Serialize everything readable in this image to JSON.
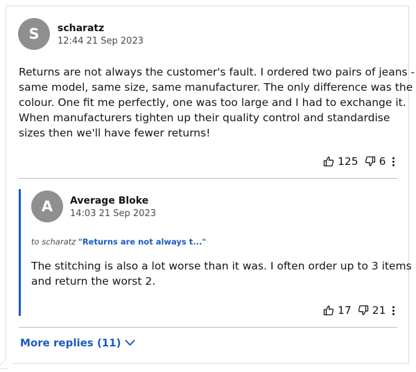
{
  "comment": {
    "avatar_letter": "S",
    "username": "scharatz",
    "timestamp": "12:44 21 Sep 2023",
    "body_lines": [
      "Returns are not always the customer's fault. I ordered two pairs of jeans -",
      "same model, same size, same manufacturer. The only difference was the",
      "colour. One fit me perfectly, one was too large and I had to exchange it.",
      "When manufacturers tighten up their quality control and standardise",
      "sizes then we'll have fewer returns!"
    ],
    "upvotes": "125",
    "downvotes": "6"
  },
  "reply": {
    "avatar_letter": "A",
    "username": "Average Bloke",
    "timestamp": "14:03 21 Sep 2023",
    "to_label": "to scharatz",
    "quote": "\"Returns are not always t...\"",
    "body_lines": [
      "The stitching is also a lot worse than it was. I often order up to 3 items",
      "and return the worst 2."
    ],
    "upvotes": "17",
    "downvotes": "21"
  },
  "more_replies_label": "More replies (11)",
  "colors": {
    "accent": "#1a5ac4",
    "avatar_bg": "#8f8f8f",
    "text": "#141414"
  },
  "icons": [
    "thumbs-up-icon",
    "thumbs-down-icon",
    "more-options-icon",
    "chevron-down-icon"
  ]
}
